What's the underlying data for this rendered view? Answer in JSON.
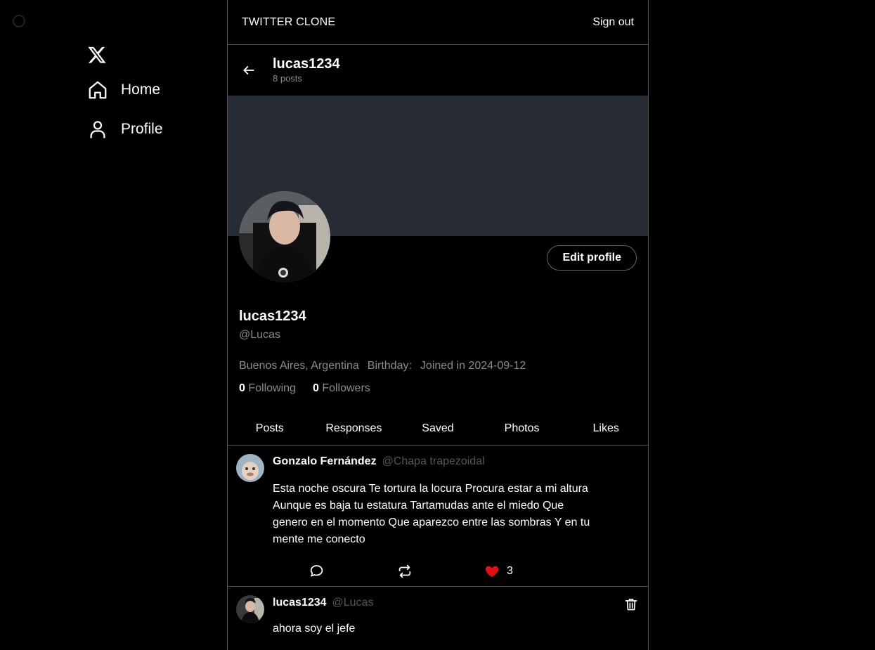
{
  "app": {
    "title": "TWITTER CLONE",
    "sign_out": "Sign out"
  },
  "nav": {
    "items": [
      {
        "label": "Home",
        "icon": "home-icon"
      },
      {
        "label": "Profile",
        "icon": "user-icon"
      }
    ]
  },
  "profile": {
    "name": "lucas1234",
    "posts_count": "8 posts",
    "handle": "@Lucas",
    "location": "Buenos Aires, Argentina",
    "birthday_label": "Birthday:",
    "joined": "Joined in 2024-09-12",
    "following_count": "0",
    "following_label": "Following",
    "followers_count": "0",
    "followers_label": "Followers",
    "edit_button": "Edit profile"
  },
  "tabs": [
    "Posts",
    "Responses",
    "Saved",
    "Photos",
    "Likes"
  ],
  "posts": [
    {
      "author": "Gonzalo Fernández",
      "handle": "@Chapa trapezoidal",
      "text": "Esta noche oscura Te tortura la locura Procura estar a mi altura Aunque es baja tu estatura Tartamudas ante el miedo Que genero en el momento Que aparezco entre las sombras Y en tu mente me conecto",
      "likes": "3"
    },
    {
      "author": "lucas1234",
      "handle": "@Lucas",
      "text": "ahora soy el jefe"
    }
  ],
  "colors": {
    "banner": "#272b33",
    "like": "#e0101b",
    "muted": "#8b8b8b"
  }
}
